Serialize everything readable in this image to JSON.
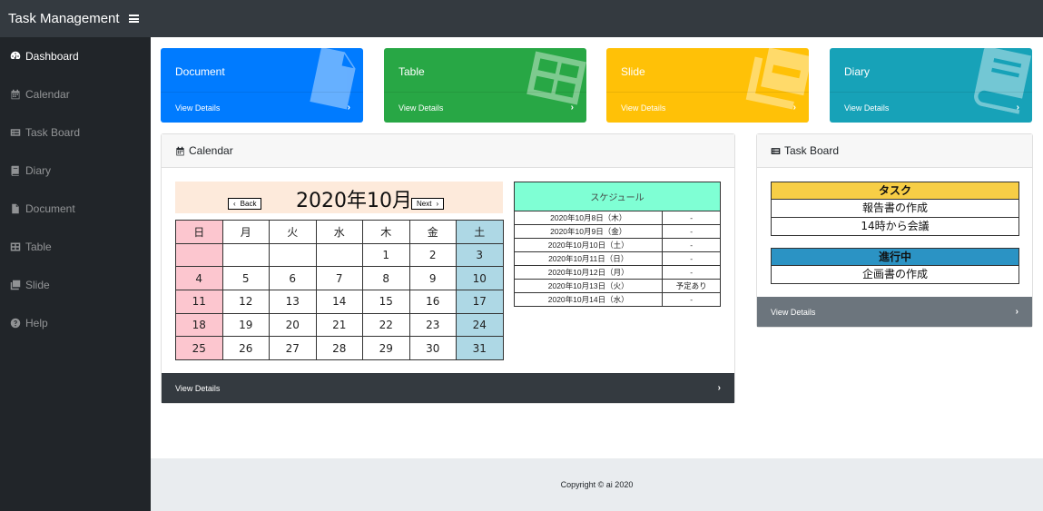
{
  "app": {
    "title": "Task Management"
  },
  "sidebar": {
    "items": [
      {
        "label": "Dashboard",
        "icon": "dashboard-icon"
      },
      {
        "label": "Calendar",
        "icon": "calendar-icon"
      },
      {
        "label": "Task Board",
        "icon": "task-board-icon"
      },
      {
        "label": "Diary",
        "icon": "book-icon"
      },
      {
        "label": "Document",
        "icon": "file-icon"
      },
      {
        "label": "Table",
        "icon": "table-icon"
      },
      {
        "label": "Slide",
        "icon": "slides-icon"
      },
      {
        "label": "Help",
        "icon": "help-icon"
      }
    ]
  },
  "tiles": [
    {
      "title": "Document",
      "link": "View Details",
      "color": "#007bff"
    },
    {
      "title": "Table",
      "link": "View Details",
      "color": "#28a745"
    },
    {
      "title": "Slide",
      "link": "View Details",
      "color": "#ffc107"
    },
    {
      "title": "Diary",
      "link": "View Details",
      "color": "#17a2b8"
    }
  ],
  "calendar_panel": {
    "title": "Calendar",
    "month": "2020年10月",
    "back": "Back",
    "next": "Next",
    "weekdays": [
      "日",
      "月",
      "火",
      "水",
      "木",
      "金",
      "土"
    ],
    "weeks": [
      [
        "",
        "",
        "",
        "",
        "1",
        "2",
        "3"
      ],
      [
        "4",
        "5",
        "6",
        "7",
        "8",
        "9",
        "10"
      ],
      [
        "11",
        "12",
        "13",
        "14",
        "15",
        "16",
        "17"
      ],
      [
        "18",
        "19",
        "20",
        "21",
        "22",
        "23",
        "24"
      ],
      [
        "25",
        "26",
        "27",
        "28",
        "29",
        "30",
        "31"
      ]
    ],
    "schedule_header": "スケジュール",
    "schedule": [
      {
        "date": "2020年10月8日（木）",
        "value": "-"
      },
      {
        "date": "2020年10月9日（金）",
        "value": "-"
      },
      {
        "date": "2020年10月10日（土）",
        "value": "-"
      },
      {
        "date": "2020年10月11日（日）",
        "value": "-"
      },
      {
        "date": "2020年10月12日（月）",
        "value": "-"
      },
      {
        "date": "2020年10月13日（火）",
        "value": "予定あり"
      },
      {
        "date": "2020年10月14日（水）",
        "value": "-"
      }
    ],
    "footer": "View Details"
  },
  "taskboard_panel": {
    "title": "Task Board",
    "groups": [
      {
        "header": "タスク",
        "color": "#f7ce46",
        "items": [
          "報告書の作成",
          "14時から会議"
        ]
      },
      {
        "header": "進行中",
        "color": "#2b93c4",
        "items": [
          "企画書の作成"
        ]
      }
    ],
    "footer": "View Details"
  },
  "footer": {
    "copyright": "Copyright © ai 2020"
  }
}
